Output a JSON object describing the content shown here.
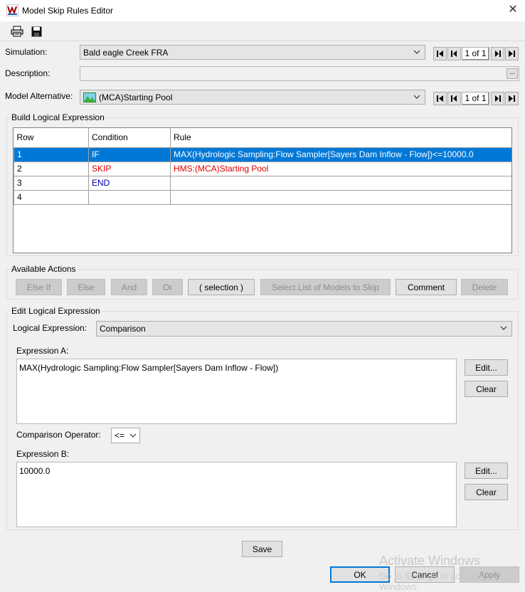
{
  "window": {
    "title": "Model Skip Rules Editor"
  },
  "simulation": {
    "label": "Simulation:",
    "value": "Bald eagle Creek FRA",
    "counter": "1 of 1"
  },
  "description": {
    "label": "Description:",
    "ellipsis": "..."
  },
  "model_alternative": {
    "label": "Model Alternative:",
    "value": "(MCA)Starting Pool",
    "counter": "1 of 1"
  },
  "build": {
    "title": "Build Logical Expression",
    "columns": [
      "Row",
      "Condition",
      "Rule"
    ],
    "rows": [
      {
        "row": "1",
        "condition": "IF",
        "rule": "MAX(Hydrologic Sampling:Flow Sampler[Sayers Dam Inflow - Flow])<=10000.0"
      },
      {
        "row": "2",
        "condition": "SKIP",
        "rule": "HMS:(MCA)Starting Pool"
      },
      {
        "row": "3",
        "condition": "END",
        "rule": ""
      },
      {
        "row": "4",
        "condition": "",
        "rule": ""
      }
    ]
  },
  "actions": {
    "title": "Available Actions",
    "else_if": "Else If",
    "else": "Else",
    "and": "And",
    "or": "Or",
    "selection": "( selection )",
    "select_list": "Select List of Models to Skip",
    "comment": "Comment",
    "delete": "Delete"
  },
  "edit": {
    "title": "Edit Logical Expression",
    "logical_label": "Logical Expression:",
    "logical_value": "Comparison",
    "expr_a_label": "Expression A:",
    "expr_a_value": "MAX(Hydrologic Sampling:Flow Sampler[Sayers Dam Inflow - Flow])",
    "edit_label": "Edit...",
    "clear_label": "Clear",
    "operator_label": "Comparison Operator:",
    "operator_value": "<=",
    "expr_b_label": "Expression B:",
    "expr_b_value": "10000.0"
  },
  "footer": {
    "save": "Save",
    "ok": "OK",
    "cancel": "Cancel",
    "apply": "Apply",
    "watermark_line1": "Activate Windows",
    "watermark_line2": "Go to Settings to activate Windows."
  },
  "colors": {
    "selection": "#0078d7",
    "skip": "#e00000",
    "end": "#0000a0"
  }
}
